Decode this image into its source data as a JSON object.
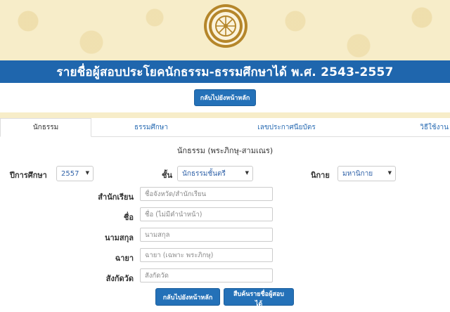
{
  "header": {
    "title": "รายชื่อผู้สอบประโยคนักธรรม-ธรรมศึกษาได้ พ.ศ. 2543-2557",
    "back_button": "กลับไปยังหน้าหลัก"
  },
  "tabs": [
    {
      "label": "นักธรรม",
      "active": true
    },
    {
      "label": "ธรรมศึกษา",
      "active": false
    },
    {
      "label": "เลขประกาศนียบัตร",
      "active": false
    },
    {
      "label": "วิธีใช้งาน",
      "active": false
    }
  ],
  "form": {
    "section_title": "นักธรรม (พระภิกษุ-สามเณร)",
    "year": {
      "label": "ปีการศึกษา",
      "value": "2557"
    },
    "level": {
      "label": "ชั้น",
      "value": "นักธรรมชั้นตรี"
    },
    "sect": {
      "label": "นิกาย",
      "value": "มหานิกาย"
    },
    "school": {
      "label": "สำนักเรียน",
      "placeholder": "ชื่อจังหวัด/สำนักเรียน"
    },
    "name": {
      "label": "ชื่อ",
      "placeholder": "ชื่อ (ไม่มีคำนำหน้า)"
    },
    "surname": {
      "label": "นามสกุล",
      "placeholder": "นามสกุล"
    },
    "monk_name": {
      "label": "ฉายา",
      "placeholder": "ฉายา (เฉพาะ พระภิกษุ)"
    },
    "temple": {
      "label": "สังกัดวัด",
      "placeholder": "สังกัดวัด"
    },
    "back_button": "กลับไปยังหน้าหลัก",
    "search_button": "สืบค้นรายชื่อผู้สอบได้"
  },
  "colors": {
    "accent": "#1f66ad",
    "banner": "#f7edc9",
    "seal": "#b5862a"
  },
  "icons": {
    "seal": "dharma-wheel-seal-logo",
    "dropdown": "caret-down-icon"
  }
}
